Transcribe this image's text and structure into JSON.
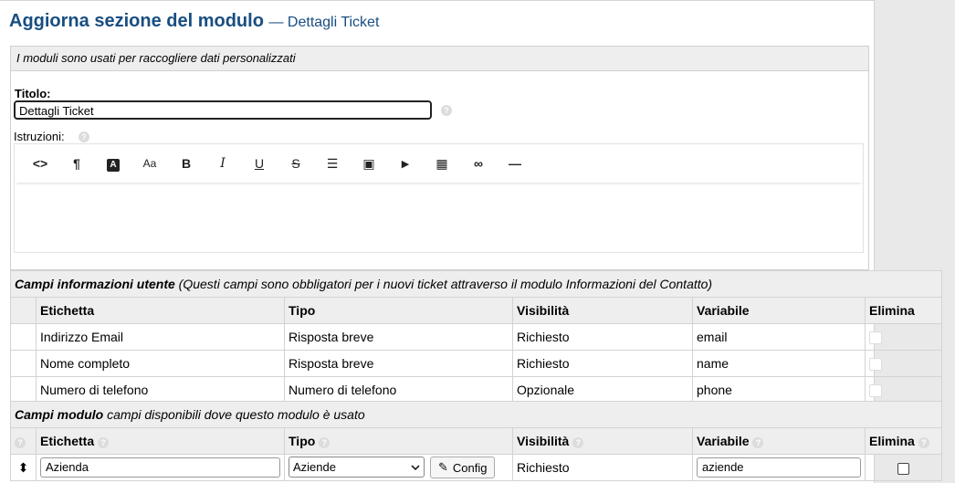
{
  "header": {
    "title": "Aggiorna sezione del modulo",
    "subtitle": "— Dettagli Ticket"
  },
  "form_panel": {
    "description": "I moduli sono usati per raccogliere dati personalizzati",
    "title_label": "Titolo:",
    "title_value": "Dettagli Ticket",
    "instructions_label": "Istruzioni:",
    "help_glyph": "?",
    "toolbar": [
      {
        "icon": "code-icon",
        "glyph": "<>"
      },
      {
        "icon": "paragraph-icon",
        "glyph": "¶"
      },
      {
        "icon": "font-color-icon",
        "glyph": "A"
      },
      {
        "icon": "font-size-icon",
        "glyph": "Aa"
      },
      {
        "icon": "bold-icon",
        "glyph": "B"
      },
      {
        "icon": "italic-icon",
        "glyph": "I"
      },
      {
        "icon": "underline-icon",
        "glyph": "U"
      },
      {
        "icon": "strikethrough-icon",
        "glyph": "S"
      },
      {
        "icon": "list-icon",
        "glyph": "☰"
      },
      {
        "icon": "image-icon",
        "glyph": "▣"
      },
      {
        "icon": "video-icon",
        "glyph": "▶"
      },
      {
        "icon": "table-icon",
        "glyph": "▦"
      },
      {
        "icon": "link-icon",
        "glyph": "∞"
      },
      {
        "icon": "horizontal-rule-icon",
        "glyph": "—"
      }
    ]
  },
  "user_fields": {
    "heading_bold": "Campi informazioni utente",
    "heading_rest": " (Questi campi sono obbligatori per i nuovi ticket attraverso il modulo Informazioni del Contatto)",
    "columns": [
      "Etichetta",
      "Tipo",
      "Visibilità",
      "Variabile",
      "Elimina"
    ],
    "rows": [
      {
        "label": "Indirizzo Email",
        "type": "Risposta breve",
        "visibility": "Richiesto",
        "variable": "email"
      },
      {
        "label": "Nome completo",
        "type": "Risposta breve",
        "visibility": "Richiesto",
        "variable": "name"
      },
      {
        "label": "Numero di telefono",
        "type": "Numero di telefono",
        "visibility": "Opzionale",
        "variable": "phone"
      }
    ]
  },
  "form_fields": {
    "heading_bold": "Campi modulo",
    "heading_rest": " campi disponibili dove questo modulo è usato",
    "columns": [
      "Etichetta",
      "Tipo",
      "Visibilità",
      "Variabile",
      "Elimina"
    ],
    "row": {
      "sort_glyph": "⬍",
      "label": "Azienda",
      "type": "Aziende",
      "config_label": "Config",
      "config_icon_glyph": "✎",
      "visibility": "Richiesto",
      "variable": "aziende"
    }
  },
  "colors": {
    "title": "#184e81",
    "header_bg": "#eeeeee",
    "border": "#d3d3d3"
  }
}
